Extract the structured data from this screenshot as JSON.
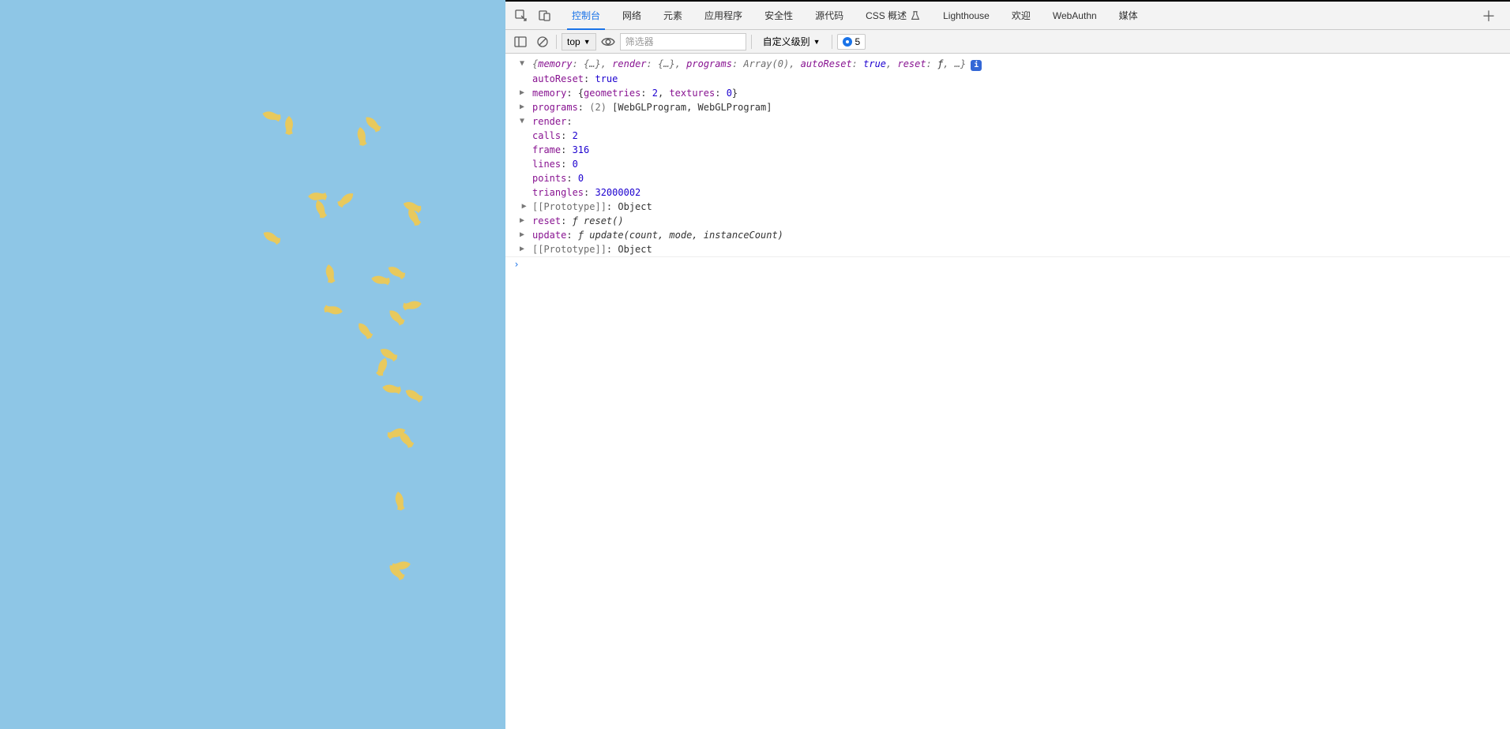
{
  "devtools": {
    "tabs": [
      "控制台",
      "网络",
      "元素",
      "应用程序",
      "安全性",
      "源代码",
      "CSS 概述",
      "Lighthouse",
      "欢迎",
      "WebAuthn",
      "媒体"
    ],
    "active_tab": "控制台",
    "css_overview_has_flask": true
  },
  "toolbar": {
    "context": "top",
    "filter_placeholder": "筛选器",
    "level_label": "自定义级别",
    "issues_count": "5"
  },
  "console": {
    "summary_prefix": "{",
    "summary_parts": [
      {
        "k": "memory",
        "v": "{…}"
      },
      {
        "k": "render",
        "v": "{…}"
      },
      {
        "k": "programs",
        "v": "Array(0)"
      },
      {
        "k": "autoReset",
        "v": "true",
        "vt": "bool"
      },
      {
        "k": "reset",
        "v": "ƒ",
        "vt": "fn"
      }
    ],
    "summary_suffix": ", …}",
    "autoReset_key": "autoReset",
    "autoReset_val": "true",
    "memory": {
      "key": "memory",
      "prefix": "{",
      "parts": [
        {
          "k": "geometries",
          "v": "2"
        },
        {
          "k": "textures",
          "v": "0"
        }
      ],
      "suffix": "}"
    },
    "programs": {
      "key": "programs",
      "count": "(2)",
      "val": "[WebGLProgram, WebGLProgram]"
    },
    "render": {
      "key": "render",
      "props": [
        {
          "k": "calls",
          "v": "2"
        },
        {
          "k": "frame",
          "v": "316"
        },
        {
          "k": "lines",
          "v": "0"
        },
        {
          "k": "points",
          "v": "0"
        },
        {
          "k": "triangles",
          "v": "32000002"
        }
      ],
      "proto_key": "[[Prototype]]",
      "proto_val": "Object"
    },
    "reset": {
      "key": "reset",
      "sig": "ƒ reset()"
    },
    "update": {
      "key": "update",
      "sig": "ƒ update(count, mode, instanceCount)"
    },
    "proto": {
      "key": "[[Prototype]]",
      "val": "Object"
    }
  },
  "fish_positions": [
    [
      330,
      140,
      15
    ],
    [
      352,
      152,
      90
    ],
    [
      444,
      166,
      80
    ],
    [
      458,
      150,
      45
    ],
    [
      508,
      255,
      20
    ],
    [
      510,
      268,
      60
    ],
    [
      488,
      338,
      30
    ],
    [
      388,
      242,
      0
    ],
    [
      392,
      258,
      70
    ],
    [
      424,
      246,
      140
    ],
    [
      468,
      348,
      10
    ],
    [
      508,
      380,
      170
    ],
    [
      330,
      294,
      30
    ],
    [
      404,
      340,
      80
    ],
    [
      408,
      386,
      190
    ],
    [
      488,
      395,
      45
    ],
    [
      448,
      412,
      50
    ],
    [
      470,
      458,
      110
    ],
    [
      510,
      494,
      30
    ],
    [
      488,
      542,
      160
    ],
    [
      500,
      550,
      50
    ],
    [
      492,
      628,
      80
    ],
    [
      494,
      710,
      170
    ],
    [
      488,
      718,
      45
    ],
    [
      478,
      442,
      30
    ],
    [
      482,
      486,
      10
    ]
  ]
}
